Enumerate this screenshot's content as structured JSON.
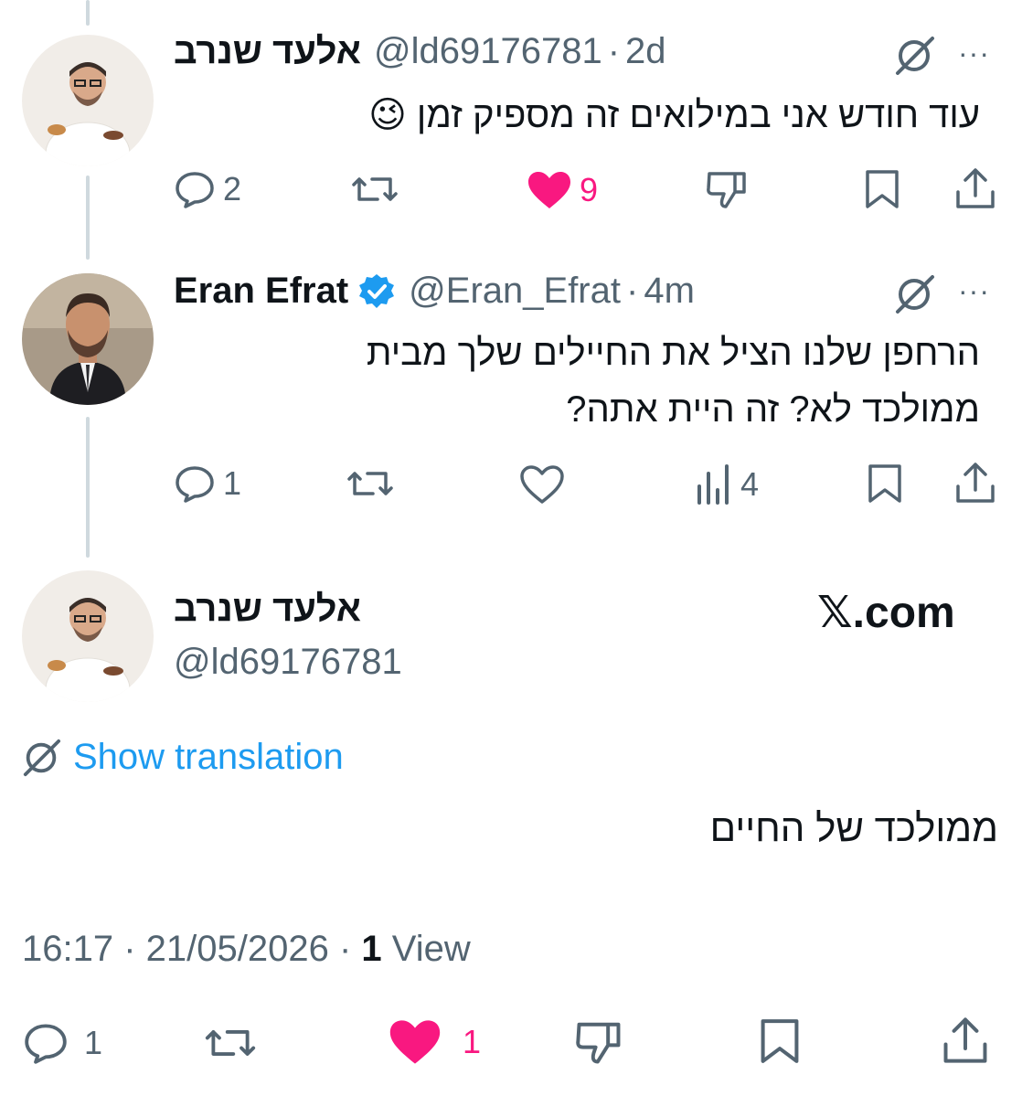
{
  "colors": {
    "accent": "#1d9bf0",
    "like": "#f91880",
    "muted": "#536471",
    "text": "#0f1419",
    "thread": "#cfd9de"
  },
  "tweets": [
    {
      "name": "אלעד שנרב",
      "handle": "@ld69176781",
      "dot": "·",
      "time": "2d",
      "text": "עוד חודש אני במילואים זה מספיק זמן 😉",
      "actions": {
        "replies": "2",
        "likes": "9",
        "liked": true
      }
    },
    {
      "name": "Eran Efrat",
      "verified": true,
      "handle": "@Eran_Efrat",
      "dot": "·",
      "time": "4m",
      "text_line1": "הרחפן שלנו הציל את החיילים שלך מבית",
      "text_line2": "ממולכד לא? זה היית אתה?",
      "actions": {
        "replies": "1",
        "views": "4",
        "liked": false
      }
    }
  ],
  "main": {
    "name": "אלעד שנרב",
    "handle": "@ld69176781",
    "site": "𝕏.com",
    "show_translation": "Show translation",
    "text": "ממולכד של החיים",
    "timestamp": "16:17 · 21/05/2026 ·",
    "views_count": "1",
    "views_label": "View",
    "actions": {
      "replies": "1",
      "likes": "1",
      "liked": true
    }
  }
}
